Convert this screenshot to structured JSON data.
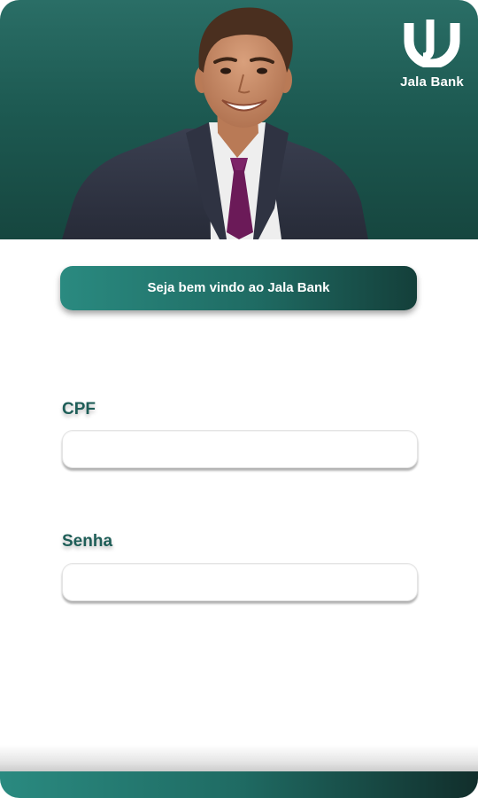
{
  "brand": {
    "name": "Jala Bank",
    "logo_icon": "jala-bank-logo-icon"
  },
  "hero": {
    "image": "smiling-businessman-photo"
  },
  "welcome": {
    "label": "Seja bem vindo ao Jala Bank"
  },
  "form": {
    "cpf": {
      "label": "CPF",
      "value": "",
      "placeholder": ""
    },
    "senha": {
      "label": "Senha",
      "value": "",
      "placeholder": ""
    }
  },
  "colors": {
    "primary": "#1f6b63",
    "primary_light": "#2a8a80",
    "primary_dark": "#143f3a",
    "label": "#1f5e58"
  }
}
